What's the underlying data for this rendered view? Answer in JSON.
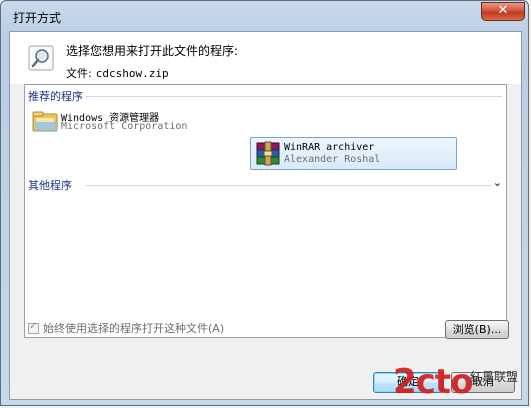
{
  "window": {
    "title": "打开方式",
    "close_label": "✕"
  },
  "prompt": {
    "text": "选择您想用来打开此文件的程序:",
    "file_label": "文件:",
    "file_name": "cdcshow.zip"
  },
  "groups": {
    "recommended": "推荐的程序",
    "other": "其他程序"
  },
  "programs": [
    {
      "name": "Windows 资源管理器",
      "publisher": "Microsoft Corporation",
      "icon": "folder-icon",
      "selected": false
    },
    {
      "name": "WinRAR archiver",
      "publisher": "Alexander Roshal",
      "icon": "winrar-icon",
      "selected": true
    }
  ],
  "always_use": {
    "label": "始终使用选择的程序打开这种文件(A)",
    "checked": true,
    "enabled": false
  },
  "buttons": {
    "browse": "浏览(B)...",
    "ok": "确定",
    "cancel": "取消"
  },
  "watermark": {
    "logo": "2cto",
    "sub": "红黑联盟"
  },
  "colors": {
    "group_header": "#1e3287",
    "selection_border": "#7da2ce",
    "close_button": "#c0391d"
  }
}
